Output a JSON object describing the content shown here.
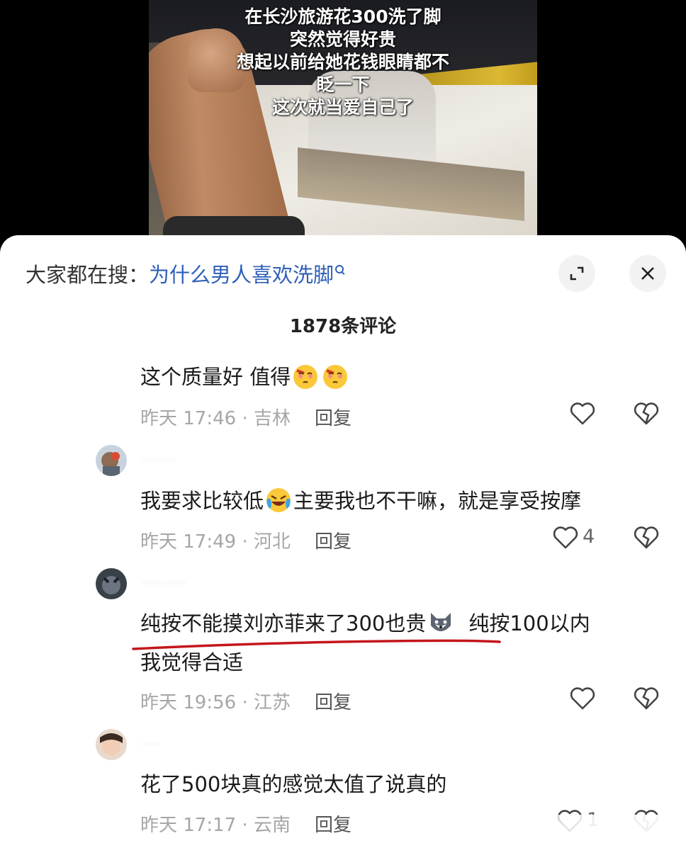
{
  "video": {
    "caption_lines": [
      "在长沙旅游花300洗了脚",
      "突然觉得好贵",
      "想起以前给她花钱眼睛都不",
      "眨一下",
      "这次就当爱自己了"
    ]
  },
  "search": {
    "label": "大家都在搜：",
    "query": "为什么男人喜欢洗脚"
  },
  "comments_count": "1878条评论",
  "comments": [
    {
      "text": "这个质量好  值得",
      "time_location": "昨天 17:46 · 吉林",
      "reply_label": "回复",
      "likes": ""
    },
    {
      "text_before_emoji": "我要求比较低",
      "text_after_emoji": "主要我也不干嘛，就是享受按摩",
      "time_location": "昨天 17:49 · 河北",
      "reply_label": "回复",
      "likes": "4"
    },
    {
      "text_line1_before_emoji": "纯按不能摸刘亦菲来了300也贵",
      "text_line1_after_emoji": "纯按100以内",
      "text_line2": "我觉得合适",
      "time_location": "昨天 19:56 · 江苏",
      "reply_label": "回复",
      "likes": ""
    },
    {
      "text": "花了500块真的感觉太值了说真的",
      "time_location": "昨天 17:17 · 云南",
      "reply_label": "回复",
      "likes": "1"
    }
  ],
  "icons": {
    "expand": "expand-icon",
    "close": "close-icon",
    "like": "heart-outline-icon",
    "dislike": "broken-heart-icon",
    "search": "search-icon"
  },
  "colors": {
    "query_link": "#2f5fb8",
    "underline_mark": "#c4161c",
    "meta_gray": "#a6a6a6"
  }
}
